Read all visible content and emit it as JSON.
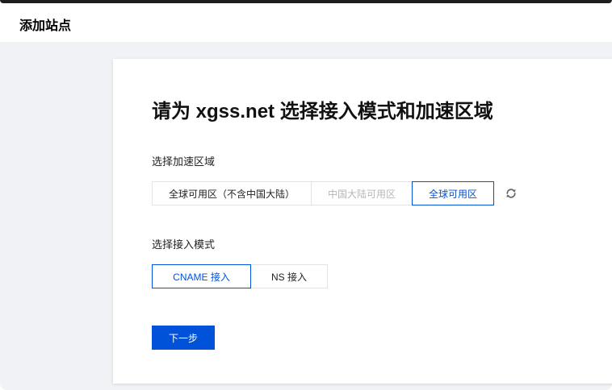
{
  "header": {
    "title": "添加站点"
  },
  "main": {
    "title": "请为 xgss.net 选择接入模式和加速区域",
    "region": {
      "label": "选择加速区域",
      "options": [
        {
          "label": "全球可用区（不含中国大陆）",
          "state": "normal"
        },
        {
          "label": "中国大陆可用区",
          "state": "disabled"
        },
        {
          "label": "全球可用区",
          "state": "selected"
        }
      ],
      "refresh_icon": "refresh-icon"
    },
    "mode": {
      "label": "选择接入模式",
      "options": [
        {
          "label": "CNAME 接入",
          "state": "selected"
        },
        {
          "label": "NS 接入",
          "state": "normal"
        }
      ]
    },
    "next_label": "下一步"
  },
  "colors": {
    "accent": "#0052d9",
    "page_background": "#f0f2f5",
    "disabled_text": "#b7b7b7"
  }
}
